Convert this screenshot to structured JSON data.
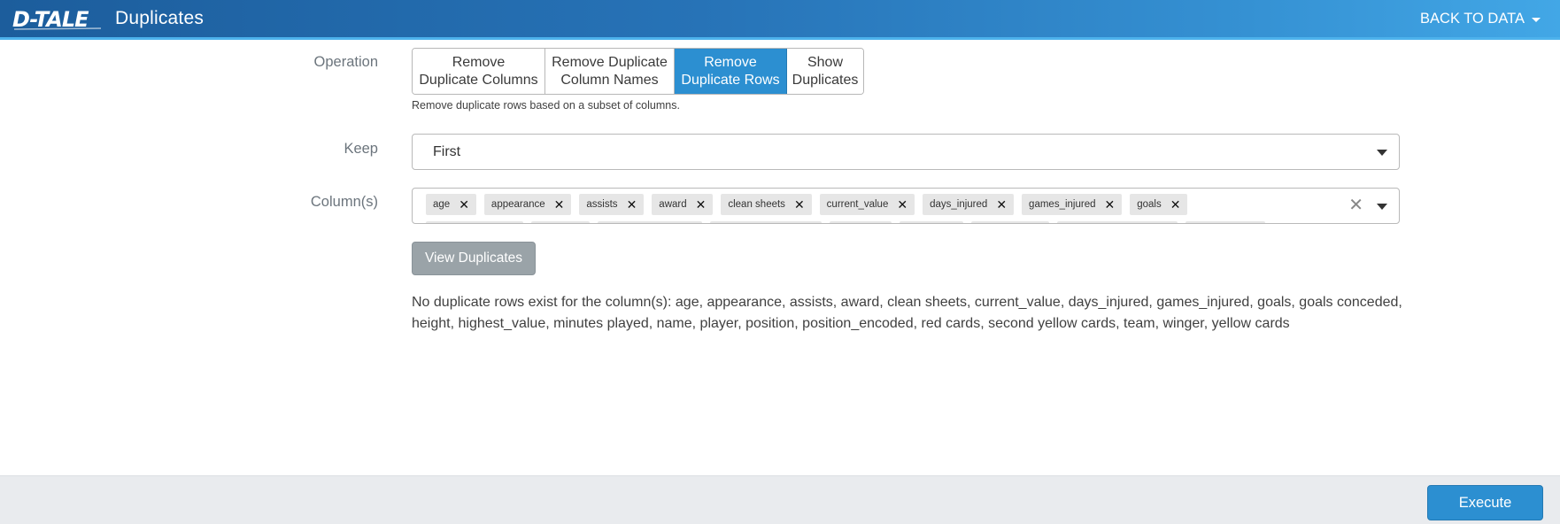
{
  "header": {
    "logo_text": "D-TALE",
    "title": "Duplicates",
    "back_label": "BACK TO DATA"
  },
  "operation": {
    "label": "Operation",
    "options": [
      {
        "label": "Remove\nDuplicate Columns",
        "active": false
      },
      {
        "label": "Remove Duplicate\nColumn Names",
        "active": false
      },
      {
        "label": "Remove\nDuplicate Rows",
        "active": true
      },
      {
        "label": "Show\nDuplicates",
        "active": false
      }
    ],
    "description": "Remove duplicate rows based on a subset of columns."
  },
  "keep": {
    "label": "Keep",
    "value": "First"
  },
  "columns": {
    "label": "Column(s)",
    "selected": [
      "age",
      "appearance",
      "assists",
      "award",
      "clean sheets",
      "current_value",
      "days_injured",
      "games_injured",
      "goals"
    ]
  },
  "view_button_label": "View Duplicates",
  "result_message": "No duplicate rows exist for the column(s): age, appearance, assists, award, clean sheets, current_value, days_injured, games_injured, goals, goals conceded, height, highest_value, minutes played, name, player, position, position_encoded, red cards, second yellow cards, team, winger, yellow cards",
  "footer": {
    "execute_label": "Execute"
  },
  "colors": {
    "header_start": "#1c5d9c",
    "header_end": "#42a7e6",
    "accent": "#2c8fd1",
    "disabled_button": "#9aa3a8",
    "footer_bg": "#e9ebee"
  }
}
